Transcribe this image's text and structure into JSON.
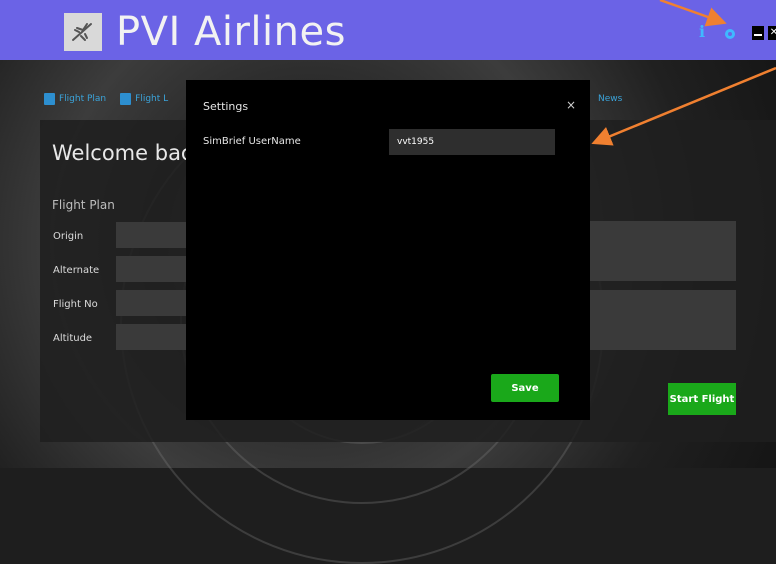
{
  "app": {
    "title": "PVI Airlines"
  },
  "titlebar": {
    "info_icon": "info-icon",
    "settings_icon": "gear-icon",
    "minimize_icon": "minimize-icon",
    "close_label": "✕"
  },
  "nav": {
    "items": [
      {
        "label": "Flight Plan",
        "icon": "briefcase-icon"
      },
      {
        "label": "Flight L",
        "icon": "briefcase-icon"
      }
    ],
    "news_label": "News"
  },
  "main": {
    "welcome": "Welcome back,",
    "section_title": "Flight Plan",
    "fields": {
      "origin": "Origin",
      "alternate": "Alternate",
      "flight_no": "Flight No",
      "altitude": "Altitude"
    },
    "start_button": "Start Flight"
  },
  "settings": {
    "title": "Settings",
    "close_label": "×",
    "simbrief_label": "SimBrief UserName",
    "simbrief_value": "vvt1955",
    "save_label": "Save"
  },
  "colors": {
    "titlebar": "#6b63e6",
    "accent_green": "#1aa81a",
    "annotation_arrow": "#f08030"
  }
}
